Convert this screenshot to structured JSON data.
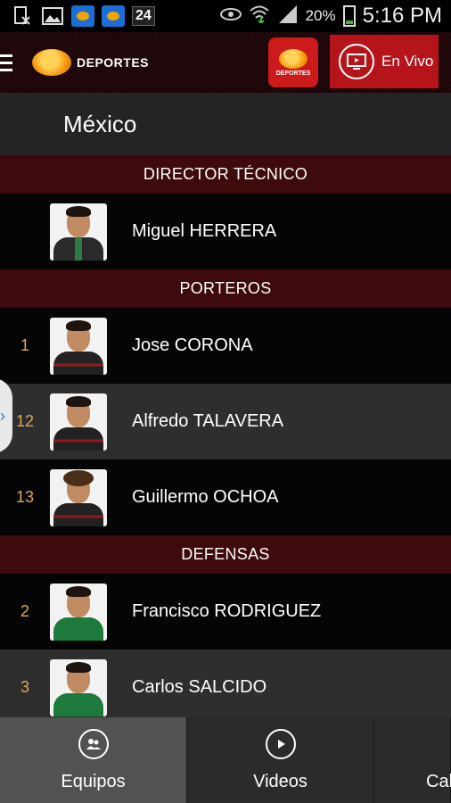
{
  "status_bar": {
    "icons": [
      "bx-icon",
      "gallery-icon",
      "televisa-app-icon",
      "televisa-app-icon",
      "24-icon"
    ],
    "badge_24": "24",
    "battery_pct": "20%",
    "time": "5:16 PM"
  },
  "header": {
    "logo_text": "DEPORTES",
    "deportes_button_label": "DEPORTES",
    "live_button_label": "En Vivo"
  },
  "page": {
    "title": "México"
  },
  "roster": {
    "sections": [
      {
        "title": "DIRECTOR TÉCNICO",
        "players": [
          {
            "number": "",
            "name": "Miguel HERRERA"
          }
        ]
      },
      {
        "title": "PORTEROS",
        "players": [
          {
            "number": "1",
            "name": "Jose CORONA"
          },
          {
            "number": "12",
            "name": "Alfredo TALAVERA"
          },
          {
            "number": "13",
            "name": "Guillermo OCHOA"
          }
        ]
      },
      {
        "title": "DEFENSAS",
        "players": [
          {
            "number": "2",
            "name": "Francisco RODRIGUEZ"
          },
          {
            "number": "3",
            "name": "Carlos SALCIDO"
          }
        ]
      }
    ],
    "side_tab_glyph": "›"
  },
  "bottom_nav": {
    "items": [
      {
        "label": "Equipos",
        "active": true
      },
      {
        "label": "Videos",
        "active": false
      },
      {
        "label": "Cal",
        "active": false
      }
    ]
  },
  "colors": {
    "section_bg": "#3e0a0c",
    "number_color": "#d9a95a",
    "live_red": "#b5141b",
    "accent_orange": "#f59a0c"
  }
}
